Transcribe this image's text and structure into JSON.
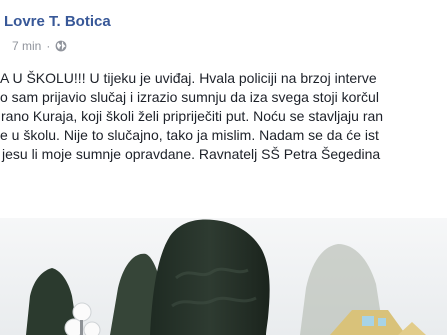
{
  "post": {
    "author": "Lovre T. Botica",
    "time": "7 min",
    "dot": "·",
    "privacy_icon": "globe-icon",
    "text_lines": [
      "A U ŠKOLU!!! U tijeku je uviđaj. Hvala policiji na brzoj interve",
      "o sam prijavio slučaj i izrazio sumnju da iza svega stoji korčul",
      "rano Kuraja, koji školi želi pripriječiti put. Noću se stavljaju ran",
      "e u školu. Nije to slučajno, tako ja mislim. Nadam se da će ist",
      "jesu li moje sumnje opravdane. Ravnatelj SŠ Petra Šegedina"
    ]
  },
  "colors": {
    "author": "#385898",
    "meta": "#90949c",
    "text": "#1d2129",
    "sky": "#f3f5f6",
    "tree": "#233026"
  }
}
